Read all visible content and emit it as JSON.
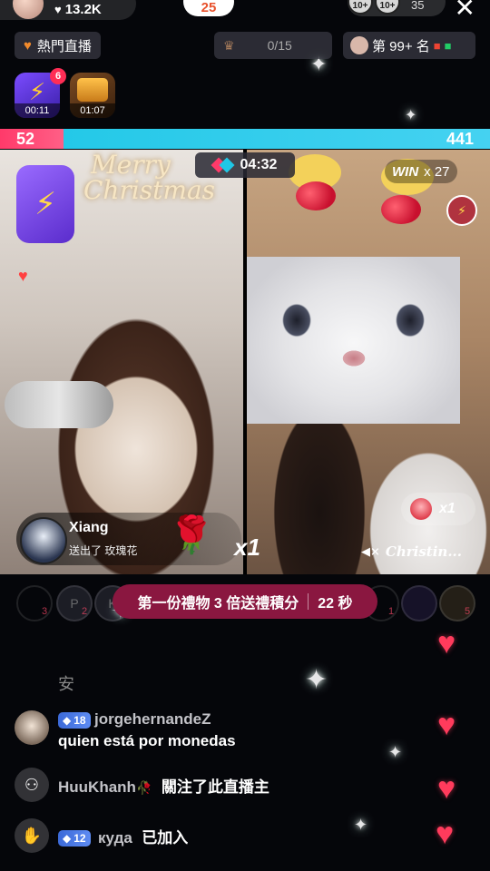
{
  "top": {
    "likes": "13.2K",
    "gift_count": "25",
    "viewer_badges": [
      "10+",
      "10+"
    ],
    "viewer_count": "35"
  },
  "row2": {
    "hot_live": "熱門直播",
    "score": "0/15",
    "rank": "第 99+ 名"
  },
  "boosts": [
    {
      "timer": "00:11",
      "badge": "6"
    },
    {
      "timer": "01:07"
    }
  ],
  "battle": {
    "left_score": "52",
    "right_score": "441",
    "timer": "04:32",
    "win_label": "WIN",
    "win_count": "x 27"
  },
  "left_video": {
    "merry": "Merry",
    "christmas": "Christmas",
    "gift_sender": "Xiang",
    "gift_text": "送出了 玫瑰花",
    "gift_multiplier": "x1"
  },
  "right_video": {
    "gift_multiplier": "x1",
    "host_name": "Christin..."
  },
  "contributors_left": [
    {
      "initial": "",
      "num": "3"
    },
    {
      "initial": "P",
      "num": "2"
    },
    {
      "initial": "K",
      "num": ""
    }
  ],
  "contributors_right": [
    {
      "initial": "",
      "num": "1"
    },
    {
      "initial": "",
      "num": ""
    },
    {
      "initial": "",
      "num": "5"
    }
  ],
  "promo": {
    "text": "第一份禮物 3 倍送禮積分",
    "seconds": "22 秒"
  },
  "chat": {
    "faded": "安",
    "messages": [
      {
        "level": "18",
        "user": "jorgehernandeZ",
        "text": "quien está por monedas"
      },
      {
        "user": "HuuKhanh",
        "text": "關注了此直播主"
      },
      {
        "level": "12",
        "user": "куда",
        "text": "已加入"
      }
    ]
  },
  "colors": {
    "battle_red": "#ff3a6a",
    "battle_blue": "#1fc7e6",
    "promo_bg": "#8a1740",
    "heart": "#ff3b5c"
  }
}
